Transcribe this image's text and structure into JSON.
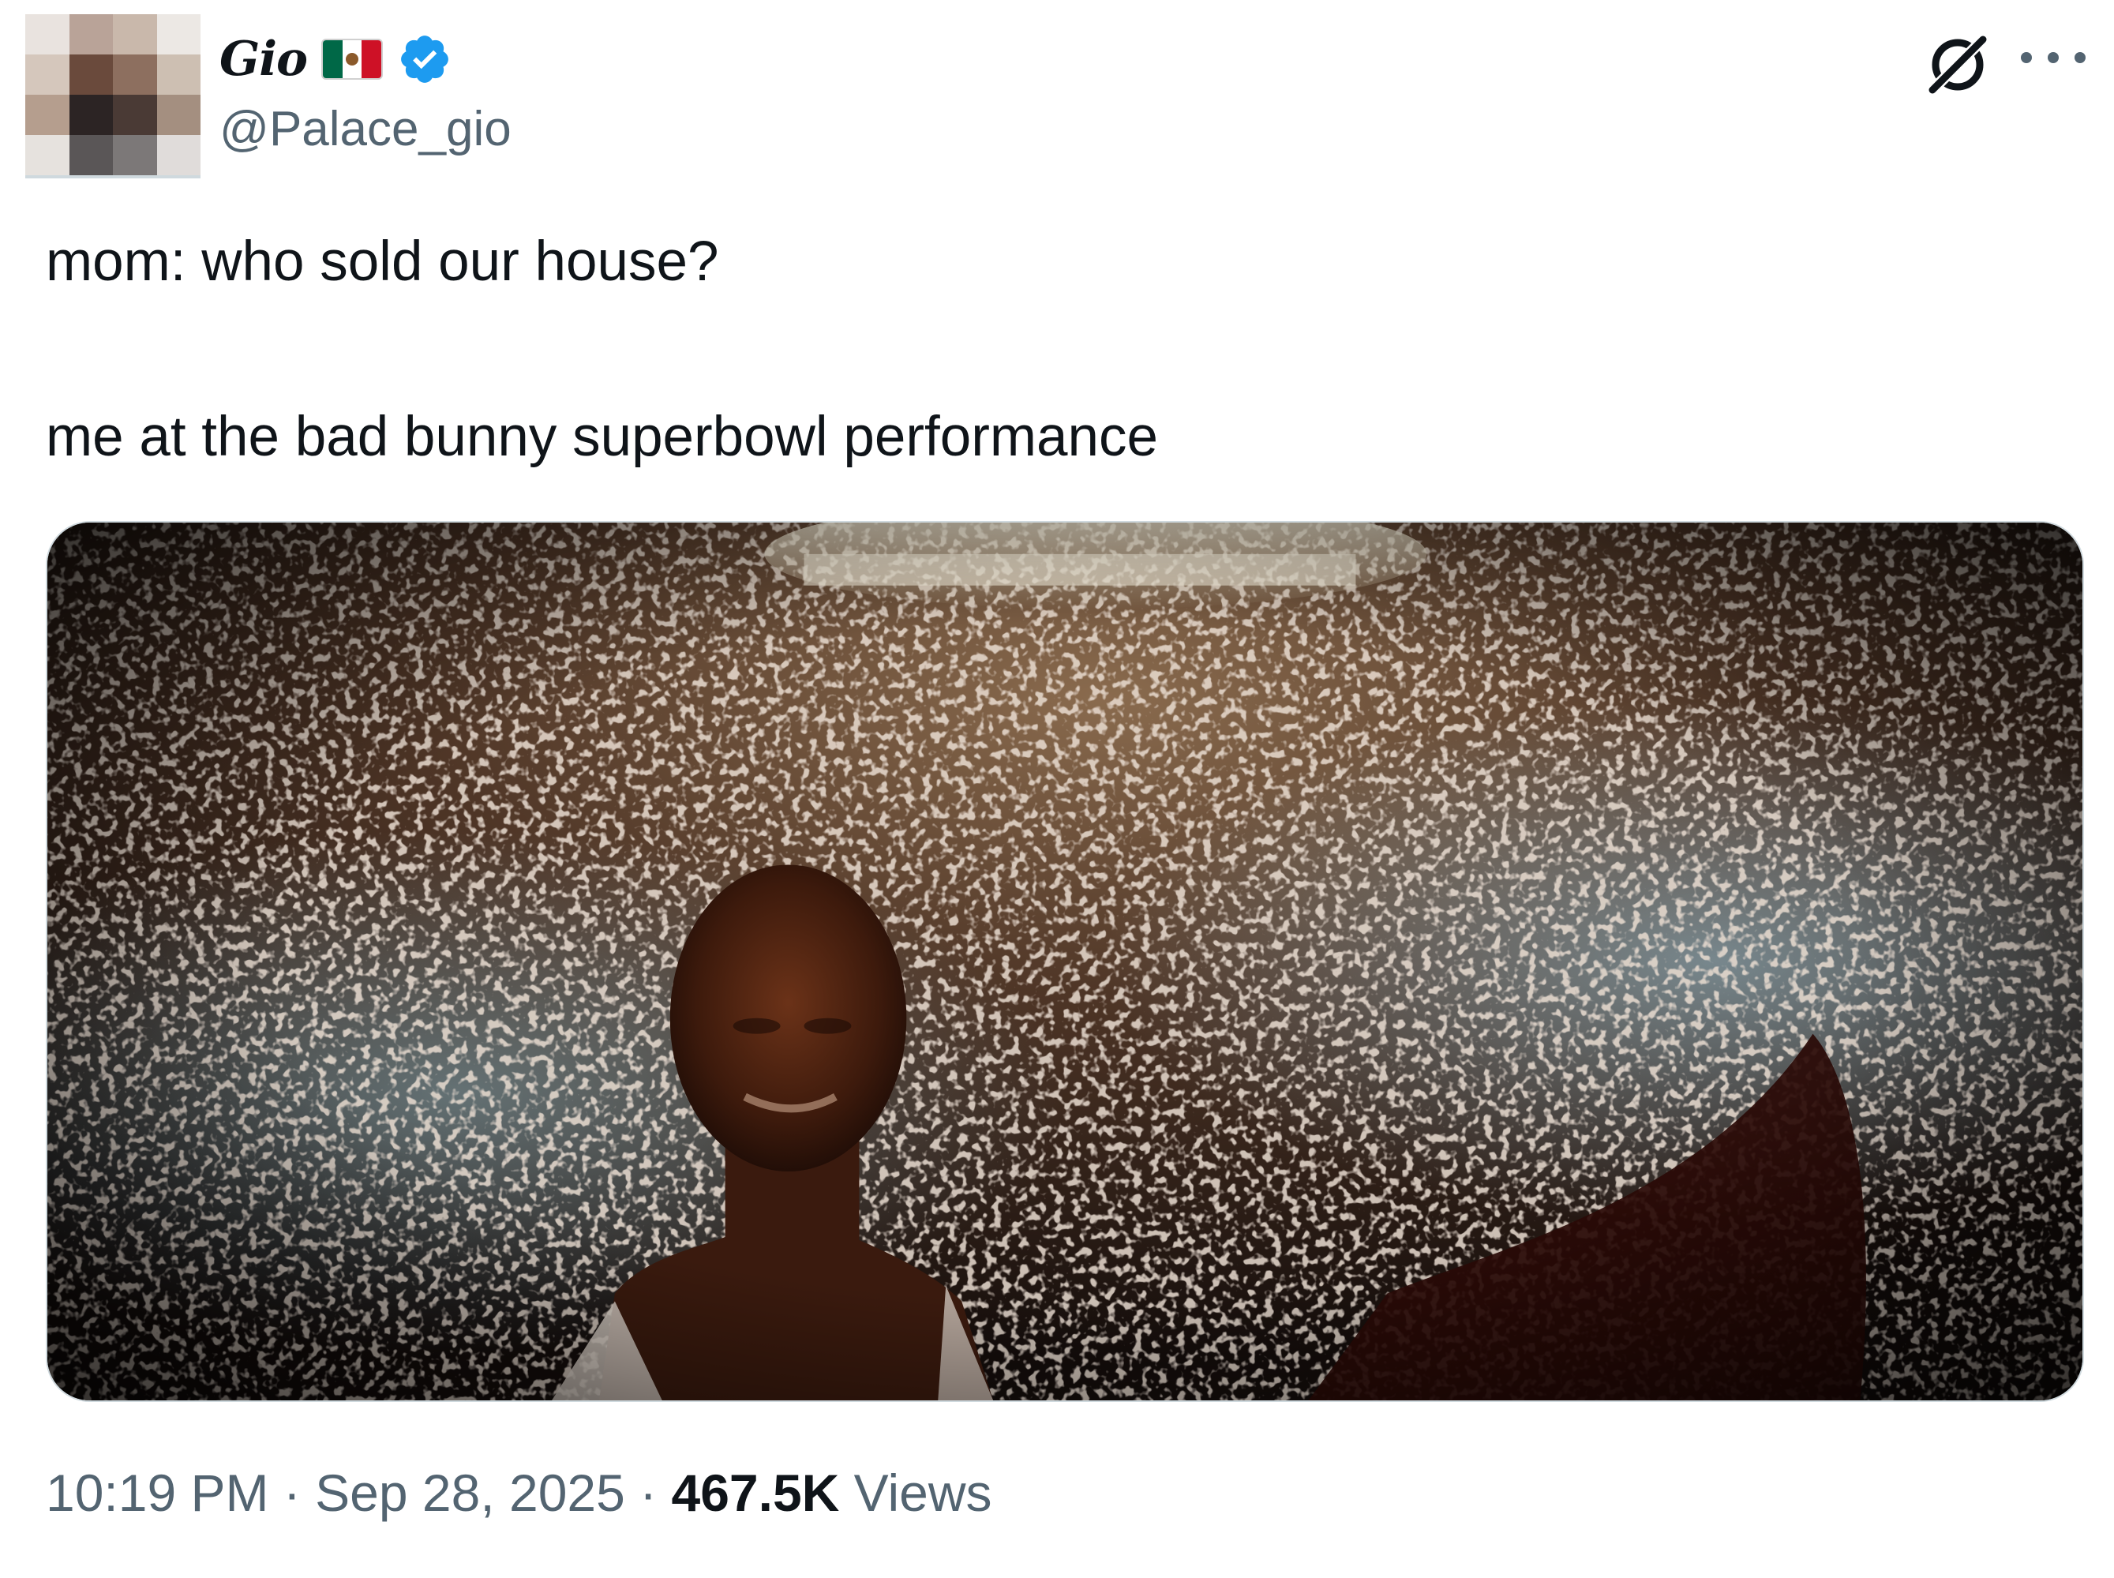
{
  "author": {
    "display_name": "Gio",
    "flag_icon": "mexico-flag-icon",
    "verified_icon": "verified-badge-icon",
    "verified_color": "#1d9bf0",
    "handle": "@Palace_gio",
    "avatar_icon": "pixelated-avatar"
  },
  "header_actions": {
    "grok_icon": "grok-icon",
    "more_icon": "more-options-icon"
  },
  "tweet": {
    "line1": "mom: who sold our house?",
    "line2": "me at the bad bunny superbowl performance"
  },
  "media": {
    "type": "image",
    "description_icon": "crowd-selfie-photo"
  },
  "meta": {
    "time": "10:19 PM",
    "sep1": " · ",
    "date": "Sep 28, 2025",
    "sep2": " · ",
    "views_count": "467.5K",
    "views_label": " Views"
  }
}
